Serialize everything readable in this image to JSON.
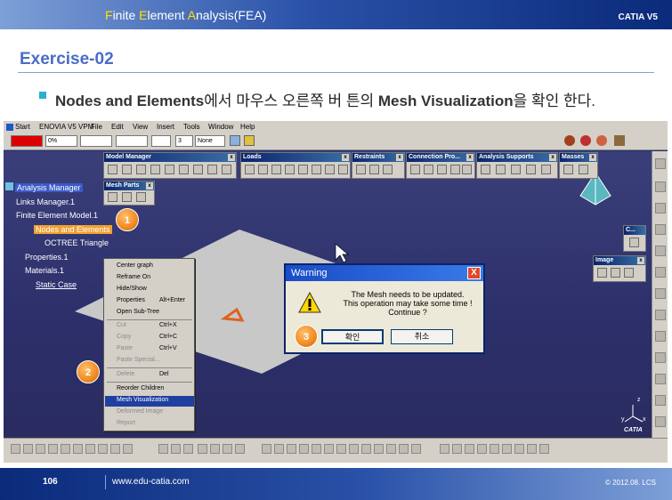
{
  "header": {
    "title_parts": [
      "F",
      "inite ",
      "E",
      "lement ",
      "A",
      "nalysis(FEA)"
    ],
    "brand": "CATIA V5"
  },
  "exercise": {
    "title": "Exercise-02"
  },
  "instruction": {
    "pre": "Nodes and Elements",
    "mid": "에서 마우스 오른쪽 버 튼의 ",
    "bold2": "Mesh Visualization",
    "post": "을 확인 한다."
  },
  "app": {
    "menubar": [
      "Start",
      "ENOVIA V5 VPM",
      "File",
      "Edit",
      "View",
      "Insert",
      "Tools",
      "Window",
      "Help"
    ],
    "property_bar": {
      "percent": "0%",
      "layer_num": "3",
      "layer_name": "None"
    },
    "toolbars": [
      {
        "title": "Model Manager"
      },
      {
        "title": "Loads"
      },
      {
        "title": "Restraints"
      },
      {
        "title": "Connection Pro..."
      },
      {
        "title": "Analysis Supports"
      },
      {
        "title": "Masses"
      },
      {
        "title": "Mesh Parts"
      },
      {
        "title": "C..."
      },
      {
        "title": "Image"
      }
    ],
    "tree": {
      "root": "Analysis Manager",
      "links": "Links Manager.1",
      "fem": "Finite Element Model.1",
      "nodes": "Nodes and Elements",
      "octree": "OCTREE Triangle",
      "properties": "Properties.1",
      "materials": "Materials.1",
      "static": "Static Case"
    },
    "context_menu": {
      "items": [
        "Center graph",
        "Reframe On",
        "Hide/Show",
        "Properties",
        "Open Sub-Tree",
        "Cut",
        "Copy",
        "Paste",
        "Paste Special...",
        "Delete",
        "Reorder Children",
        "Mesh Visualization",
        "Deformed Image",
        "Report"
      ],
      "accels": {
        "properties": "Alt+Enter",
        "cut": "Ctrl+X",
        "copy": "Ctrl+C",
        "paste": "Ctrl+V",
        "delete": "Del"
      }
    },
    "dialog": {
      "title": "Warning",
      "lines": [
        "The Mesh needs to be updated.",
        "This operation may take some time !",
        "Continue ?"
      ],
      "ok_label": "확인",
      "cancel_label": "취소"
    },
    "badges": [
      "1",
      "2",
      "3"
    ],
    "axis_labels": {
      "x": "x",
      "y": "y",
      "z": "z"
    },
    "catia_logo": "CATIA"
  },
  "footer": {
    "page": "106",
    "url": "www.edu-catia.com",
    "copyright": "© 2012.08. LCS"
  }
}
